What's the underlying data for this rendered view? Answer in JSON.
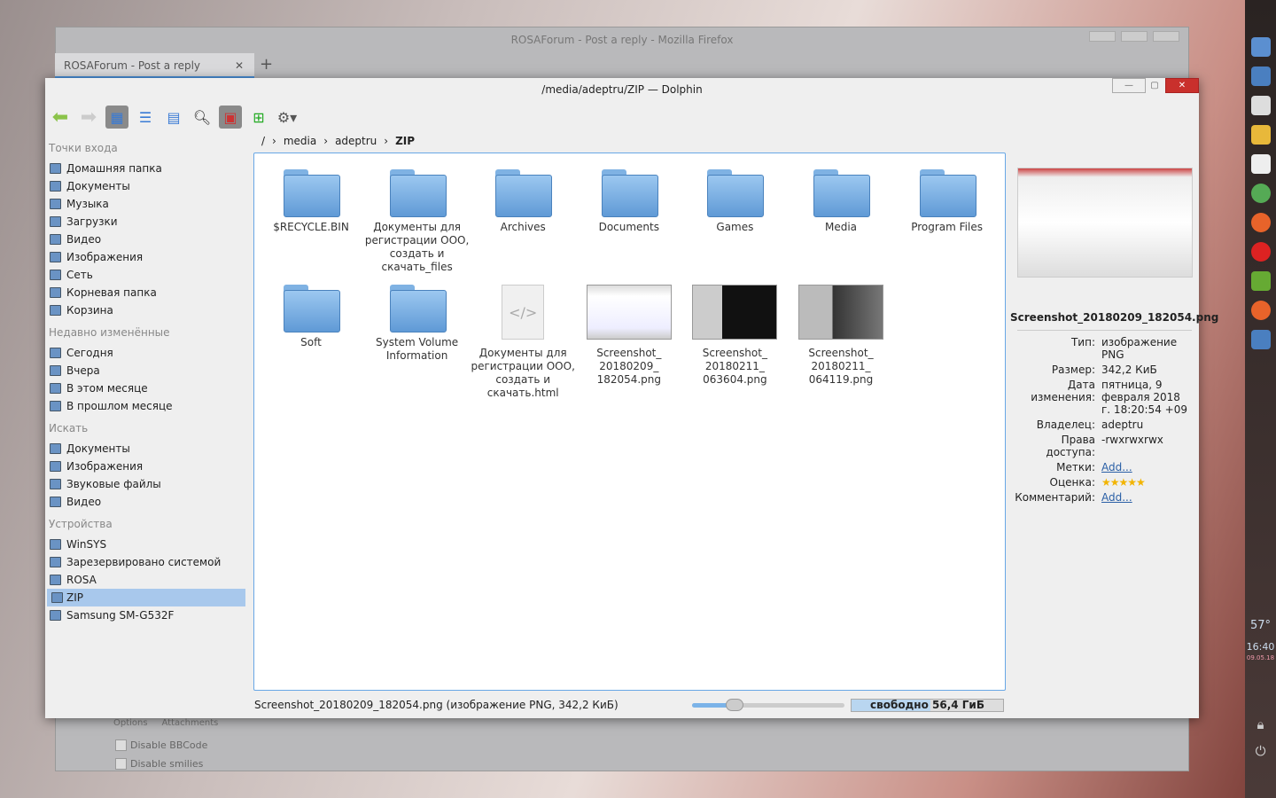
{
  "firefox": {
    "title": "ROSAForum - Post a reply - Mozilla Firefox",
    "tab": "ROSAForum - Post a reply",
    "tab_close": "✕",
    "new_tab": "+",
    "options_tab": "Options",
    "attachments_tab": "Attachments",
    "cb1": "Disable BBCode",
    "cb2": "Disable smilies"
  },
  "dolphin": {
    "title": "/media/adeptru/ZIP — Dolphin"
  },
  "breadcrumb": [
    "/",
    "media",
    "adeptru",
    "ZIP"
  ],
  "sidebar": {
    "places_title": "Точки входа",
    "places": [
      "Домашняя папка",
      "Документы",
      "Музыка",
      "Загрузки",
      "Видео",
      "Изображения",
      "Сеть",
      "Корневая папка",
      "Корзина"
    ],
    "recent_title": "Недавно изменённые",
    "recent": [
      "Сегодня",
      "Вчера",
      "В этом месяце",
      "В прошлом месяце"
    ],
    "search_title": "Искать",
    "search": [
      "Документы",
      "Изображения",
      "Звуковые файлы",
      "Видео"
    ],
    "devices_title": "Устройства",
    "devices": [
      "WinSYS",
      "Зарезервировано системой",
      "ROSA",
      "ZIP",
      "Samsung SM-G532F"
    ]
  },
  "files": [
    "$RECYCLE.BIN",
    "Документы для регистрации ООО, создать и скачать_files",
    "Archives",
    "Documents",
    "Games",
    "Media",
    "Program Files",
    "Soft",
    "System Volume Information",
    "Документы для регистрации ООО, создать и скачать.html",
    "Screenshot_ 20180209_ 182054.png",
    "Screenshot_ 20180211_ 063604.png",
    "Screenshot_ 20180211_ 064119.png"
  ],
  "info": {
    "name": "Screenshot_20180209_182054.png",
    "rows": [
      [
        "Тип:",
        "изображение PNG"
      ],
      [
        "Размер:",
        "342,2 КиБ"
      ],
      [
        "Дата изменения:",
        "пятница, 9 февраля 2018 г. 18:20:54 +09"
      ],
      [
        "Владелец:",
        "adeptru"
      ],
      [
        "Права доступа:",
        "-rwxrwxrwx"
      ],
      [
        "Метки:",
        "Add..."
      ],
      [
        "Оценка:",
        "★★★★★"
      ],
      [
        "Комментарий:",
        "Add..."
      ]
    ],
    "rating": 5
  },
  "status": {
    "text": "Screenshot_20180209_182054.png (изображение PNG, 342,2 КиБ)",
    "zoom_percent": 28,
    "free": "свободно 56,4 ГиБ",
    "used_percent": 52
  },
  "panel": {
    "temp": "57°",
    "time": "16:40",
    "date": "09.05.18"
  }
}
